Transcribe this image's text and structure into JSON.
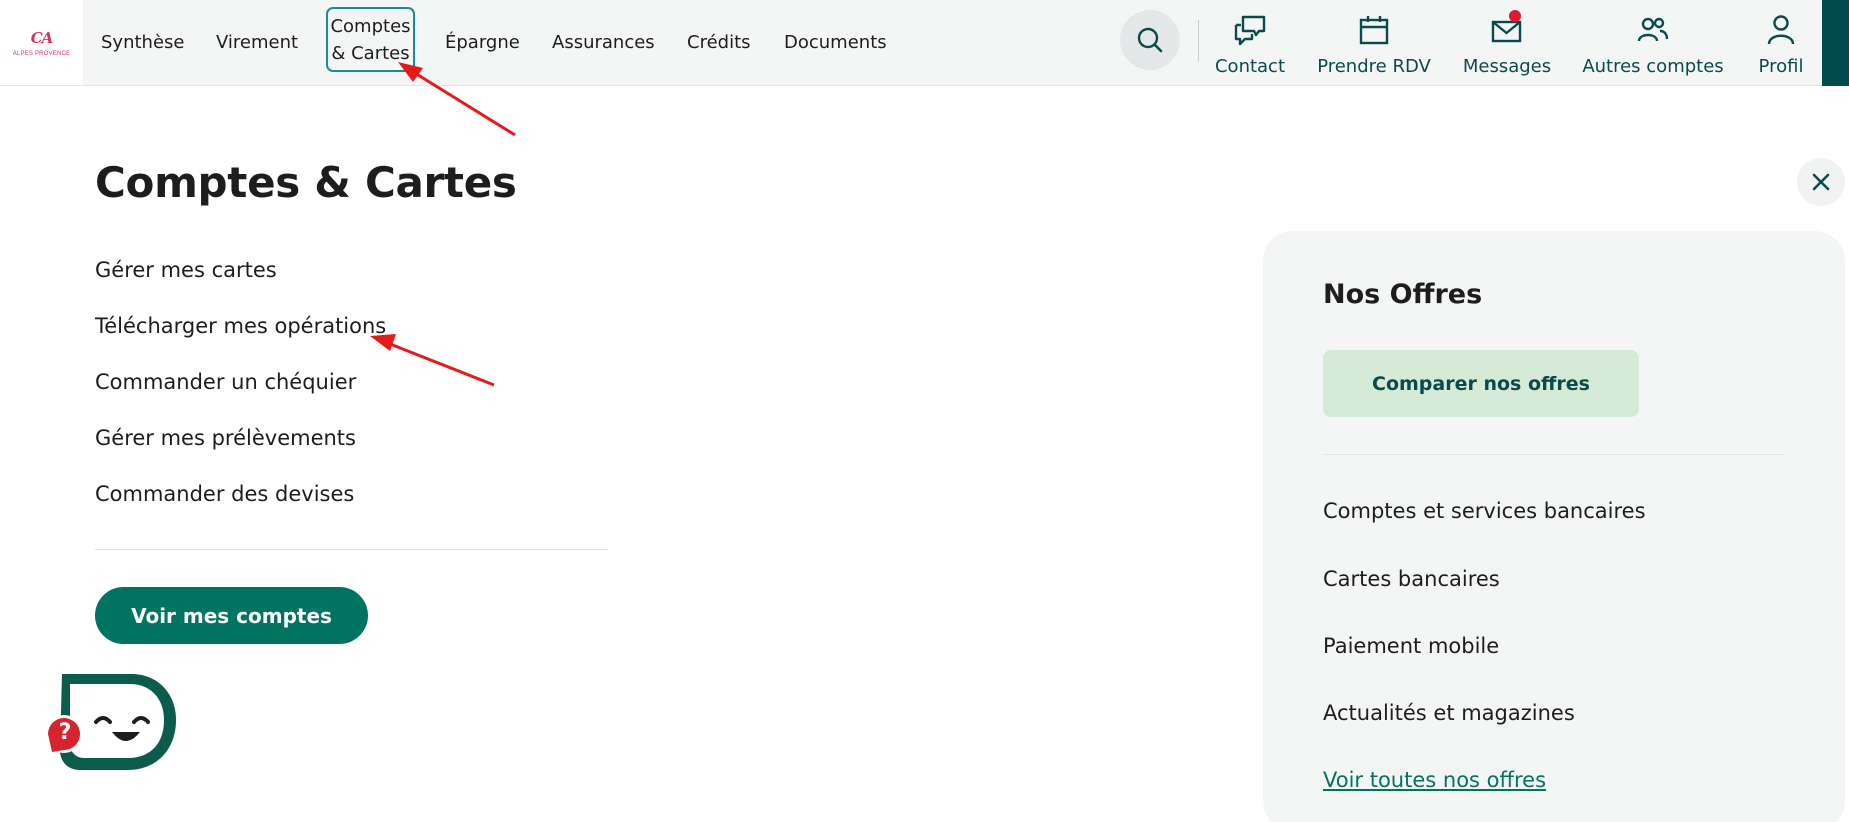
{
  "brand": {
    "logo_mark": "CA",
    "logo_sub": "ALPES PROVENCE",
    "accent": "#007461",
    "dark_teal": "#0b4a4c",
    "active_outline": "#1a8d92",
    "logo_color": "#d4335a"
  },
  "nav": {
    "items": [
      {
        "label": "Synthèse"
      },
      {
        "label": "Virement"
      },
      {
        "label": "Comptes",
        "label2": "& Cartes",
        "active": true
      },
      {
        "label": "Épargne"
      },
      {
        "label": "Assurances"
      },
      {
        "label": "Crédits"
      },
      {
        "label": "Documents"
      }
    ]
  },
  "tools": {
    "search_icon": "search-icon",
    "items": [
      {
        "label": "Contact",
        "icon": "chat-bubbles-icon"
      },
      {
        "label": "Prendre RDV",
        "icon": "calendar-icon"
      },
      {
        "label": "Messages",
        "icon": "envelope-icon",
        "has_notification": true
      },
      {
        "label": "Autres comptes",
        "icon": "people-icon"
      },
      {
        "label": "Profil",
        "icon": "user-icon"
      }
    ]
  },
  "menu": {
    "title": "Comptes & Cartes",
    "links": [
      "Gérer mes cartes",
      "Télécharger mes opérations",
      "Commander un chéquier",
      "Gérer mes prélèvements",
      "Commander des devises"
    ],
    "primary_button": "Voir mes comptes"
  },
  "offers": {
    "title": "Nos Offres",
    "compare_button": "Comparer nos offres",
    "links": [
      "Comptes et services bancaires",
      "Cartes bancaires",
      "Paiement mobile",
      "Actualités et magazines"
    ],
    "see_all": "Voir toutes nos offres"
  },
  "chatbot": {
    "help_glyph": "?"
  }
}
